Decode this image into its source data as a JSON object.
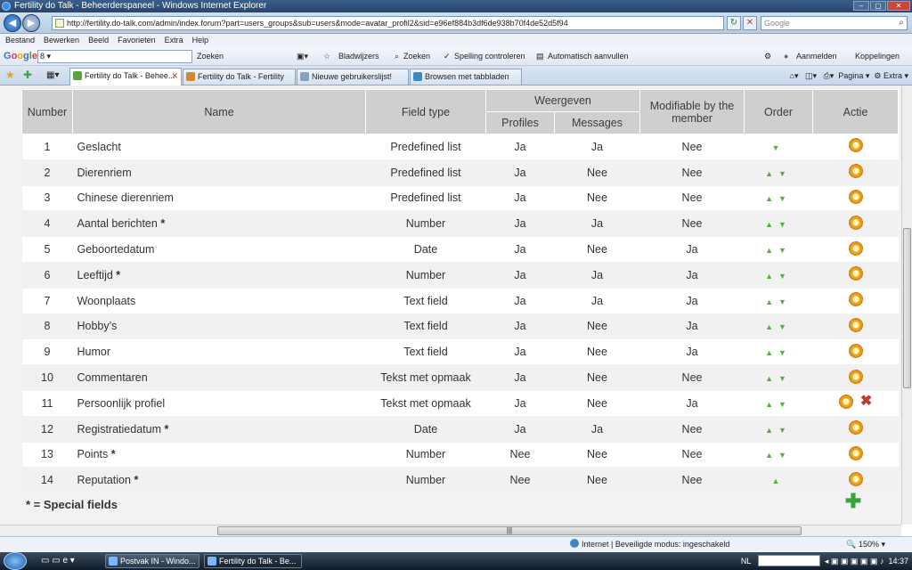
{
  "window": {
    "title": "Fertility do Talk - Beheerderspaneel - Windows Internet Explorer"
  },
  "address": {
    "url": "http://fertility.do-talk.com/admin/index.forum?part=users_groups&sub=users&mode=avatar_profil2&sid=e96ef884b3df6de938b70f4de52d5f94"
  },
  "search": {
    "placeholder": "Google"
  },
  "menu": [
    "Bestand",
    "Bewerken",
    "Beeld",
    "Favorieten",
    "Extra",
    "Help"
  ],
  "gbar": {
    "logo": [
      "G",
      "o",
      "o",
      "g",
      "l",
      "e"
    ],
    "input_value": "8",
    "zoeken": "Zoeken",
    "bladwijzers": "Bladwijzers",
    "zoeken2": "Zoeken",
    "spelling": "Spelling controleren",
    "auto": "Automatisch aanvullen",
    "aanmelden": "Aanmelden",
    "koppelingen": "Koppelingen"
  },
  "tabs": [
    {
      "label": "Fertility do Talk - Behee..."
    },
    {
      "label": "Fertility do Talk - Fertility"
    },
    {
      "label": "Nieuwe gebruikerslijst!"
    },
    {
      "label": "Browsen met tabbladen"
    }
  ],
  "commandbar": {
    "pagina": "Pagina",
    "extra": "Extra"
  },
  "table": {
    "headers": {
      "number": "Number",
      "name": "Name",
      "field_type": "Field type",
      "weergeven": "Weergeven",
      "profiles": "Profiles",
      "messages": "Messages",
      "modifiable": "Modifiable by the member",
      "order": "Order",
      "actie": "Actie"
    },
    "rows": [
      {
        "num": "1",
        "name": "Geslacht",
        "star": "",
        "type": "Predefined list",
        "profiles": "Ja",
        "messages": "Ja",
        "modifiable": "Nee",
        "order": "▼"
      },
      {
        "num": "2",
        "name": "Dierenriem",
        "star": "",
        "type": "Predefined list",
        "profiles": "Ja",
        "messages": "Nee",
        "modifiable": "Nee",
        "order": "▲▼"
      },
      {
        "num": "3",
        "name": "Chinese dierenriem",
        "star": "",
        "type": "Predefined list",
        "profiles": "Ja",
        "messages": "Nee",
        "modifiable": "Nee",
        "order": "▲▼"
      },
      {
        "num": "4",
        "name": "Aantal berichten",
        "star": "*",
        "type": "Number",
        "profiles": "Ja",
        "messages": "Ja",
        "modifiable": "Nee",
        "order": "▲▼"
      },
      {
        "num": "5",
        "name": "Geboortedatum",
        "star": "",
        "type": "Date",
        "profiles": "Ja",
        "messages": "Nee",
        "modifiable": "Ja",
        "order": "▲▼"
      },
      {
        "num": "6",
        "name": "Leeftijd",
        "star": "*",
        "type": "Number",
        "profiles": "Ja",
        "messages": "Ja",
        "modifiable": "Ja",
        "order": "▲▼"
      },
      {
        "num": "7",
        "name": "Woonplaats",
        "star": "",
        "type": "Text field",
        "profiles": "Ja",
        "messages": "Ja",
        "modifiable": "Ja",
        "order": "▲▼"
      },
      {
        "num": "8",
        "name": "Hobby’s",
        "star": "",
        "type": "Text field",
        "profiles": "Ja",
        "messages": "Nee",
        "modifiable": "Ja",
        "order": "▲▼"
      },
      {
        "num": "9",
        "name": "Humor",
        "star": "",
        "type": "Text field",
        "profiles": "Ja",
        "messages": "Nee",
        "modifiable": "Ja",
        "order": "▲▼"
      },
      {
        "num": "10",
        "name": "Commentaren",
        "star": "",
        "type": "Tekst met opmaak",
        "profiles": "Ja",
        "messages": "Nee",
        "modifiable": "Nee",
        "order": "▲▼"
      },
      {
        "num": "11",
        "name": "Persoonlijk profiel",
        "star": "",
        "type": "Tekst met opmaak",
        "profiles": "Ja",
        "messages": "Nee",
        "modifiable": "Ja",
        "order": "▲▼",
        "deletable": true
      },
      {
        "num": "12",
        "name": "Registratiedatum",
        "star": "*",
        "type": "Date",
        "profiles": "Ja",
        "messages": "Ja",
        "modifiable": "Nee",
        "order": "▲▼"
      },
      {
        "num": "13",
        "name": "Points",
        "star": "*",
        "type": "Number",
        "profiles": "Nee",
        "messages": "Nee",
        "modifiable": "Nee",
        "order": "▲▼"
      },
      {
        "num": "14",
        "name": "Reputation",
        "star": "*",
        "type": "Number",
        "profiles": "Nee",
        "messages": "Nee",
        "modifiable": "Nee",
        "order": "▲"
      }
    ],
    "footnote": "* = Special fields"
  },
  "statusbar": {
    "zone": "Internet | Beveiligde modus: ingeschakeld",
    "zoom": "150%"
  },
  "taskbar": {
    "items": [
      "Postvak IN - Windo...",
      "Fertility do Talk - Be..."
    ],
    "lang": "NL",
    "clock": "14:37"
  },
  "colors": {
    "accent_green": "#4db33b",
    "header_gray": "#cfcfcf",
    "gear_orange": "#f0b020",
    "delete_red": "#c0392b"
  }
}
